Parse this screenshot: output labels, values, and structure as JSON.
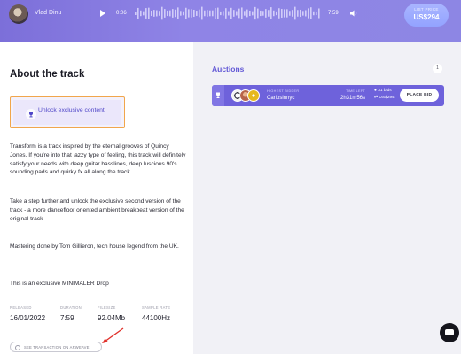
{
  "player": {
    "artist": "Vlad Dinu",
    "current_time": "0:06",
    "total_time": "7:59",
    "price_label": "LIST PRICE",
    "price_value": "US$294"
  },
  "about": {
    "title": "About the track",
    "unlock_label": "Unlock exclusive content",
    "paragraphs": [
      "Transform is a track inspired by the eternal grooves of Quincy Jones. If you're into that jazzy type of feeling, this track will definitely satisfy your needs with deep guitar basslines, deep luscious 90's sounding pads and quirky fx all along the track.",
      "Take a step further and unlock the exclusive second version of the track - a more dancefloor oriented ambient breakbeat version of the original track",
      "Mastering done by Tom Gillieron, tech house legend from the UK.",
      "This is an exclusive MINIMALER Drop"
    ],
    "stats": [
      {
        "label": "RELEASED",
        "value": "16/01/2022"
      },
      {
        "label": "DURATION",
        "value": "7:59"
      },
      {
        "label": "FILESIZE",
        "value": "92.04Mb"
      },
      {
        "label": "SAMPLE RATE",
        "value": "44100Hz"
      }
    ],
    "transaction_label": "SEE TRANSACTION ON ARWEAVE"
  },
  "auctions": {
    "title": "Auctions",
    "count": "1",
    "card": {
      "highest_bidder_label": "HIGHEST BIDDER",
      "highest_bidder_name": "Carlosinnyc",
      "time_left_label": "TIME LEFT",
      "time_left_value": "2h31m56s",
      "bids": "31 bids",
      "bid_usd": "US$294",
      "place_bid_label": "PLACE BID"
    }
  },
  "colors": {
    "accent": "#6157d6",
    "card": "#6e62db",
    "unlock_border": "#f1a64c",
    "annotation_arrow": "#e0302a"
  },
  "icons": {
    "play": "play-icon",
    "volume": "volume-icon",
    "trophy": "trophy-icon",
    "chat": "chat-icon",
    "arweave": "arweave-icon"
  }
}
